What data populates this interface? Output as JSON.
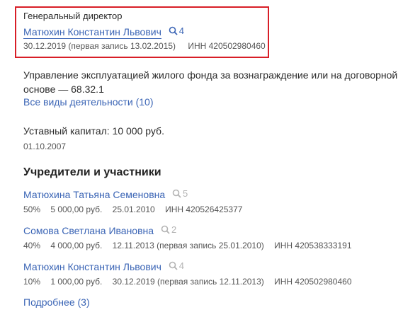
{
  "director": {
    "role": "Генеральный директор",
    "name": "Матюхин Константин Львович",
    "search_count": "4",
    "date": "30.12.2019 (первая запись 13.02.2015)",
    "inn": "ИНН 420502980460"
  },
  "activity": {
    "text_line1": "Управление эксплуатацией жилого фонда за вознаграждение или на договорной",
    "text_line2": "основе — 68.32.1",
    "all_link": "Все виды деятельности (10)"
  },
  "capital": {
    "label": "Уставный капитал: 10 000 руб.",
    "date": "01.10.2007"
  },
  "founders": {
    "heading": "Учредители и участники",
    "items": [
      {
        "name": "Матюхина Татьяна Семеновна",
        "search_count": "5",
        "share": "50%",
        "amount": "5 000,00 руб.",
        "date": "25.01.2010",
        "inn": "ИНН 420526425377"
      },
      {
        "name": "Сомова Светлана Ивановна",
        "search_count": "2",
        "share": "40%",
        "amount": "4 000,00 руб.",
        "date": "12.11.2013 (первая запись 25.01.2010)",
        "inn": "ИНН 420538333191"
      },
      {
        "name": "Матюхин Константин Львович",
        "search_count": "4",
        "share": "10%",
        "amount": "1 000,00 руб.",
        "date": "30.12.2019 (первая запись 12.11.2013)",
        "inn": "ИНН 420502980460"
      }
    ],
    "more_link": "Подробнее (3)"
  },
  "colors": {
    "link": "#3a64b5",
    "highlight_border": "#d81e27",
    "muted_icon": "#b3b3b3"
  }
}
